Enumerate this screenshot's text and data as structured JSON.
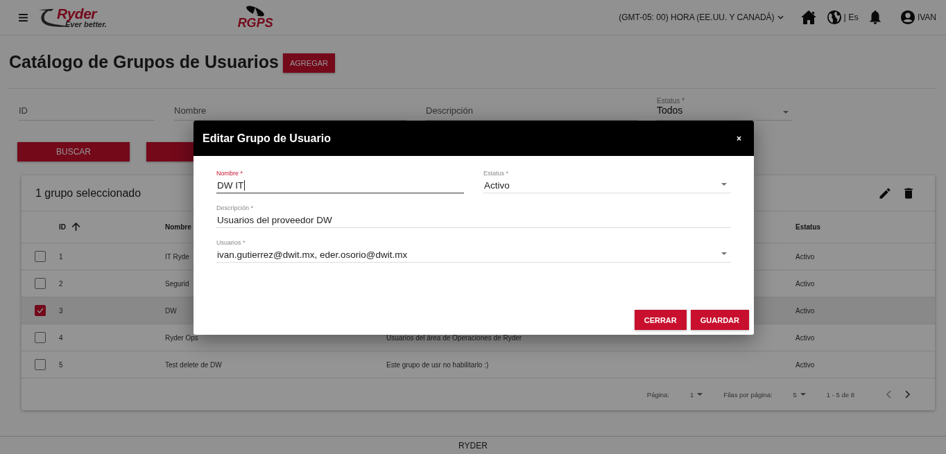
{
  "header": {
    "brand": {
      "name": "Ryder",
      "tagline": "Ever better."
    },
    "app_logo": "RGPS",
    "timezone": "(GMT-05: 00) HORA (EE.UU. Y CANADÁ)",
    "language": "| Es",
    "user": "IVAN"
  },
  "page": {
    "title": "Catálogo de Grupos de Usuarios",
    "add_button": "AGREGAR"
  },
  "filters": [
    {
      "kind": "input",
      "placeholder": "ID"
    },
    {
      "kind": "input",
      "placeholder": "Nombre"
    },
    {
      "kind": "input",
      "placeholder": "Descripción"
    },
    {
      "kind": "select",
      "label": "Estatus *",
      "value": "Todos"
    }
  ],
  "filter_buttons": [
    {
      "kind": "search",
      "label": "BUSCAR"
    },
    {
      "kind": "action"
    }
  ],
  "table": {
    "selection_title": "1 grupo seleccionado",
    "columns": [
      {
        "label": "ID",
        "sorted": true
      },
      {
        "label": "Nombre",
        "sorted": false
      },
      {
        "label": "Estatus",
        "sorted": false
      }
    ],
    "rows": [
      {
        "id": "1",
        "name": "IT Ryde",
        "status": "Activo",
        "selected": false
      },
      {
        "id": "2",
        "name": "Segurid",
        "status": "Activo",
        "selected": false
      },
      {
        "id": "3",
        "name": "DW",
        "status": "Activo",
        "selected": true
      },
      {
        "id": "4",
        "name": "Ryder Ops",
        "description": "Usuarios del área de Operaciones de Ryder",
        "status": "Activo",
        "selected": false
      },
      {
        "id": "5",
        "name": "Test delete de DW",
        "description": "Este grupo de usr no habilitarlo :)",
        "status": "Activo",
        "selected": false
      }
    ],
    "pagination": {
      "page_label": "Página:",
      "page": "1",
      "rows_label": "Filas por página:",
      "rows": "5",
      "range": "1 - 5 de 8"
    }
  },
  "footer": "RYDER",
  "dialog": {
    "title": "Editar Grupo de Usuario",
    "close": "×",
    "fields": [
      {
        "kind": "text",
        "label": "Nombre *",
        "value": "DW IT",
        "focused": true
      },
      {
        "kind": "select",
        "label": "Estatus *",
        "value": "Activo",
        "focused": false
      },
      {
        "kind": "text",
        "label": "Descripción *",
        "value": "Usuarios del proveedor DW",
        "focused": false
      },
      {
        "kind": "select",
        "label": "Usuarios *",
        "value": "ivan.gutierrez@dwit.mx, eder.osorio@dwit.mx",
        "focused": false
      }
    ],
    "buttons": [
      "CERRAR",
      "GUARDAR"
    ]
  }
}
